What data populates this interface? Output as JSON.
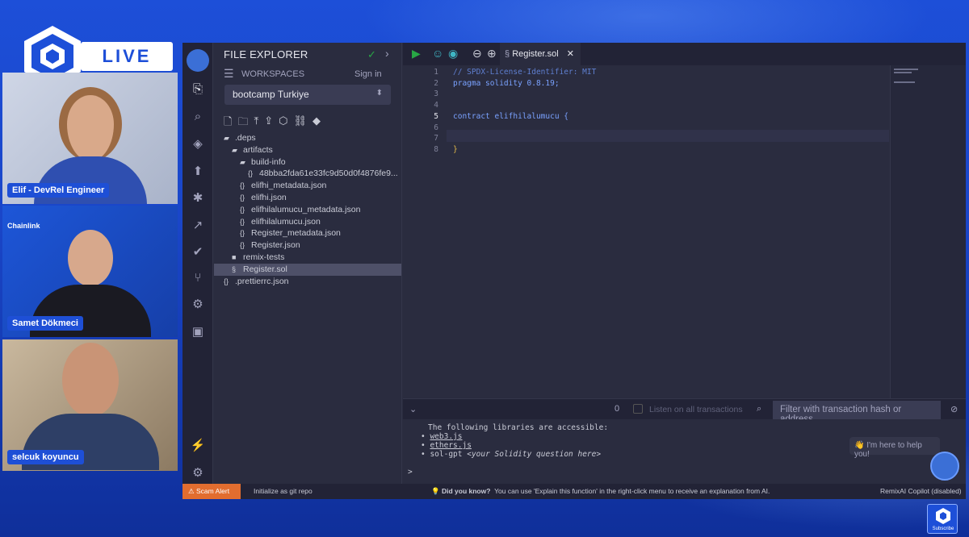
{
  "stream": {
    "live_label": "LIVE",
    "participants": [
      {
        "name": "Elif - DevRel Engineer"
      },
      {
        "name": "Samet Dökmeci",
        "brand": "Chainlink"
      },
      {
        "name": "selcuk koyuncu"
      }
    ],
    "subscribe_label": "Subscribe"
  },
  "explorer": {
    "title": "FILE EXPLORER",
    "workspaces_label": "WORKSPACES",
    "signin_label": "Sign in",
    "workspace_value": "bootcamp Turkiye",
    "tree": [
      {
        "label": ".deps",
        "icon": "folder-open-icon",
        "indent": 0
      },
      {
        "label": "artifacts",
        "icon": "folder-open-icon",
        "indent": 1
      },
      {
        "label": "build-info",
        "icon": "folder-open-icon",
        "indent": 2
      },
      {
        "label": "48bba2fda61e33fc9d50d0f4876fe9...",
        "icon": "json-icon",
        "indent": 3
      },
      {
        "label": "elifhi_metadata.json",
        "icon": "json-icon",
        "indent": 2
      },
      {
        "label": "elifhi.json",
        "icon": "json-icon",
        "indent": 2
      },
      {
        "label": "elifhilalumucu_metadata.json",
        "icon": "json-icon",
        "indent": 2
      },
      {
        "label": "elifhilalumucu.json",
        "icon": "json-icon",
        "indent": 2
      },
      {
        "label": "Register_metadata.json",
        "icon": "json-icon",
        "indent": 2
      },
      {
        "label": "Register.json",
        "icon": "json-icon",
        "indent": 2
      },
      {
        "label": "remix-tests",
        "icon": "folder-icon",
        "indent": 1
      },
      {
        "label": "Register.sol",
        "icon": "solidity-icon",
        "indent": 1,
        "selected": true
      },
      {
        "label": ".prettierrc.json",
        "icon": "json-icon",
        "indent": 0
      }
    ]
  },
  "editor": {
    "tab_label": "Register.sol",
    "lines": [
      {
        "n": "1",
        "text": "// SPDX-License-Identifier: MIT",
        "color": "#5f7fd0"
      },
      {
        "n": "2",
        "text": "pragma solidity 0.8.19;",
        "color": "#7aa2ff"
      },
      {
        "n": "3",
        "text": "",
        "color": "#c9cbd6"
      },
      {
        "n": "4",
        "text": "",
        "color": "#c9cbd6"
      },
      {
        "n": "5",
        "text": "contract elifhilalumucu {",
        "color": "#7aa2ff"
      },
      {
        "n": "6",
        "text": "",
        "color": "#c9cbd6"
      },
      {
        "n": "7",
        "text": "",
        "color": "#c9cbd6"
      },
      {
        "n": "8",
        "text": "}",
        "color": "#e0b84a"
      }
    ]
  },
  "terminal": {
    "count": "0",
    "listen_label": "Listen on all transactions",
    "filter_placeholder": "Filter with transaction hash or address",
    "intro": "The following libraries are accessible:",
    "libs": [
      "web3.js",
      "ethers.js"
    ],
    "solgpt_prefix": "sol-gpt ",
    "solgpt_hint": "<your Solidity question here>",
    "prompt": ">",
    "help_bubble": "👋 I'm here to help you!"
  },
  "status": {
    "scam_alert": "Scam Alert",
    "git": "Initialize as git repo",
    "did_you_know": "Did you know?",
    "tip": "You can use 'Explain this function' in the right-click menu to receive an explanation from AI.",
    "copilot": "RemixAI Copilot (disabled)"
  },
  "colors": {
    "background": "#1d4fd8",
    "ide_bg": "#2a2c3f",
    "accent_green": "#28a745",
    "scam_orange": "#e26d2f"
  }
}
